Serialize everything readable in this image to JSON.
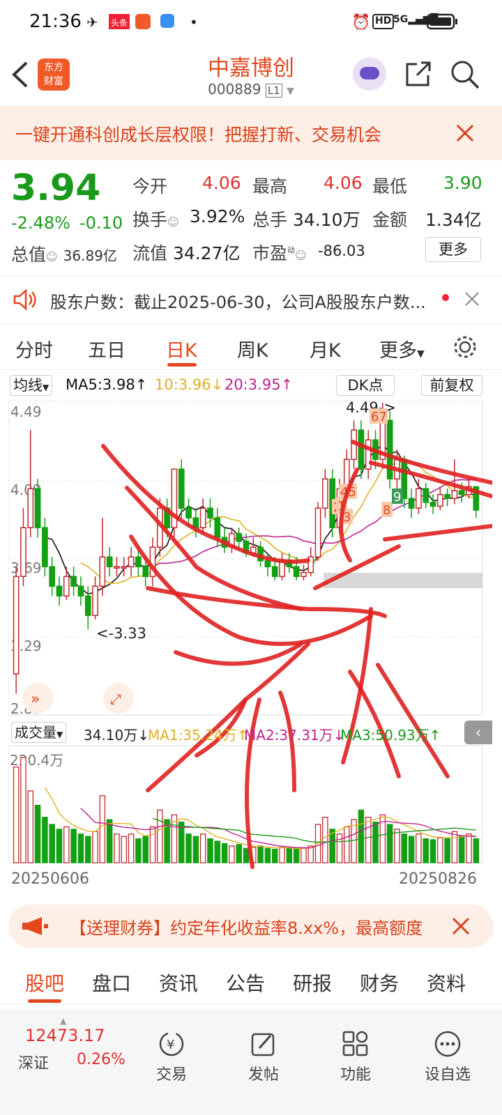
{
  "status": {
    "time": "21:36",
    "badge1": "头条",
    "net": "5G"
  },
  "header": {
    "logo_line1": "东方",
    "logo_line2": "财富",
    "title": "中嘉博创",
    "code": "000889",
    "level": "L1"
  },
  "banner": {
    "text": "一键开通科创成长层权限！把握打新、交易机会"
  },
  "quote": {
    "price": "3.94",
    "pct": "-2.48%",
    "chg": "-0.10",
    "open_label": "今开",
    "open": "4.06",
    "high_label": "最高",
    "high": "4.06",
    "low_label": "最低",
    "low": "3.90",
    "turnover_label": "换手",
    "turnover": "3.92%",
    "vol_label": "总手",
    "vol": "34.10万",
    "amt_label": "金额",
    "amt": "1.34亿",
    "mcap_label": "总值",
    "mcap": "36.89亿",
    "float_label": "流值",
    "float": "34.27亿",
    "pe_label": "市盈",
    "pe_sup": "动",
    "pe": "-86.03",
    "more": "更多"
  },
  "notice": {
    "text": "股东户数：截止2025-06-30，公司A股股东户数..."
  },
  "tabs": [
    "分时",
    "五日",
    "日K",
    "周K",
    "月K",
    "更多"
  ],
  "ma": {
    "selector": "均线",
    "ma5": "MA5:3.98",
    "ma10": "10:3.96",
    "ma20": "20:3.95",
    "dk": "DK点",
    "fq": "前复权"
  },
  "vol_legend": {
    "selector": "成交量",
    "vol": "34.10万",
    "ma1": "MA1:35.24万",
    "ma2": "MA2:37.31万",
    "ma3": "MA3:50.93万"
  },
  "chart_data": {
    "type": "candlestick",
    "y_ticks": [
      "4.49",
      "4.09",
      "3.69",
      "3.29",
      "2.89"
    ],
    "ylim": [
      2.89,
      4.49
    ],
    "high_annot": "4.49->",
    "low_annot": "<-3.33",
    "x_start": "20250606",
    "x_end": "20250826",
    "vol_max": "220.4万",
    "markers": [
      "67",
      "45",
      "2",
      "1",
      "3",
      "8",
      "9"
    ],
    "candles": [
      [
        3.1,
        3.6,
        3.0,
        3.65,
        1
      ],
      [
        3.6,
        3.85,
        3.55,
        3.95,
        1
      ],
      [
        3.85,
        4.05,
        3.8,
        4.35,
        1
      ],
      [
        4.05,
        3.85,
        3.8,
        4.1,
        0
      ],
      [
        3.85,
        3.65,
        3.6,
        3.9,
        0
      ],
      [
        3.65,
        3.55,
        3.5,
        3.7,
        0
      ],
      [
        3.55,
        3.5,
        3.45,
        3.6,
        0
      ],
      [
        3.5,
        3.6,
        3.48,
        3.65,
        1
      ],
      [
        3.6,
        3.55,
        3.5,
        3.65,
        0
      ],
      [
        3.55,
        3.5,
        3.45,
        3.6,
        0
      ],
      [
        3.5,
        3.4,
        3.33,
        3.55,
        0
      ],
      [
        3.4,
        3.55,
        3.38,
        3.6,
        1
      ],
      [
        3.55,
        3.7,
        3.5,
        3.9,
        1
      ],
      [
        3.7,
        3.65,
        3.6,
        3.75,
        0
      ],
      [
        3.65,
        3.65,
        3.6,
        3.7,
        1
      ],
      [
        3.65,
        3.65,
        3.6,
        3.7,
        1
      ],
      [
        3.65,
        3.7,
        3.6,
        3.75,
        1
      ],
      [
        3.7,
        3.65,
        3.6,
        3.75,
        0
      ],
      [
        3.65,
        3.6,
        3.55,
        3.7,
        0
      ],
      [
        3.6,
        3.75,
        3.55,
        3.8,
        1
      ],
      [
        3.75,
        3.95,
        3.7,
        4.0,
        1
      ],
      [
        3.95,
        3.85,
        3.8,
        4.0,
        0
      ],
      [
        3.85,
        4.15,
        3.8,
        4.15,
        1
      ],
      [
        4.15,
        3.95,
        3.9,
        4.2,
        0
      ],
      [
        3.95,
        3.9,
        3.85,
        4.0,
        0
      ],
      [
        3.9,
        3.85,
        3.8,
        3.95,
        0
      ],
      [
        3.85,
        3.95,
        3.82,
        4.0,
        1
      ],
      [
        3.95,
        3.9,
        3.85,
        4.0,
        0
      ],
      [
        3.9,
        3.8,
        3.75,
        3.95,
        0
      ],
      [
        3.8,
        3.75,
        3.72,
        3.85,
        0
      ],
      [
        3.75,
        3.82,
        3.72,
        3.85,
        1
      ],
      [
        3.82,
        3.78,
        3.74,
        3.85,
        0
      ],
      [
        3.78,
        3.72,
        3.7,
        3.82,
        0
      ],
      [
        3.72,
        3.75,
        3.7,
        3.8,
        1
      ],
      [
        3.75,
        3.68,
        3.65,
        3.78,
        0
      ],
      [
        3.68,
        3.65,
        3.6,
        3.72,
        0
      ],
      [
        3.65,
        3.6,
        3.58,
        3.7,
        0
      ],
      [
        3.6,
        3.68,
        3.58,
        3.72,
        1
      ],
      [
        3.68,
        3.65,
        3.62,
        3.72,
        0
      ],
      [
        3.65,
        3.6,
        3.58,
        3.7,
        0
      ],
      [
        3.6,
        3.62,
        3.58,
        3.66,
        1
      ],
      [
        3.62,
        3.7,
        3.6,
        3.75,
        1
      ],
      [
        3.7,
        3.95,
        3.68,
        3.98,
        1
      ],
      [
        3.95,
        4.1,
        3.9,
        4.15,
        1
      ],
      [
        4.1,
        3.85,
        3.8,
        4.15,
        0
      ],
      [
        3.85,
        4.05,
        3.82,
        4.1,
        1
      ],
      [
        4.05,
        4.2,
        4.0,
        4.25,
        1
      ],
      [
        4.2,
        4.35,
        4.15,
        4.4,
        1
      ],
      [
        4.35,
        4.15,
        4.1,
        4.4,
        0
      ],
      [
        4.15,
        4.3,
        4.1,
        4.35,
        1
      ],
      [
        4.3,
        4.2,
        4.15,
        4.35,
        0
      ],
      [
        4.2,
        4.4,
        4.15,
        4.49,
        1
      ],
      [
        4.4,
        4.1,
        4.05,
        4.45,
        0
      ],
      [
        4.1,
        4.2,
        4.05,
        4.25,
        1
      ],
      [
        4.2,
        4.0,
        3.95,
        4.22,
        0
      ],
      [
        4.0,
        3.95,
        3.9,
        4.05,
        0
      ],
      [
        3.95,
        4.05,
        3.92,
        4.1,
        1
      ],
      [
        4.05,
        3.98,
        3.95,
        4.08,
        0
      ],
      [
        3.98,
        3.96,
        3.92,
        4.02,
        0
      ],
      [
        3.96,
        4.02,
        3.94,
        4.06,
        1
      ],
      [
        4.02,
        4.0,
        3.96,
        4.05,
        0
      ],
      [
        4.0,
        4.04,
        3.97,
        4.2,
        1
      ],
      [
        4.04,
        4.02,
        3.98,
        4.08,
        0
      ],
      [
        4.02,
        4.06,
        4.0,
        4.1,
        1
      ],
      [
        4.06,
        3.94,
        3.9,
        4.06,
        0
      ]
    ],
    "volumes": [
      200,
      220,
      150,
      120,
      95,
      80,
      70,
      75,
      70,
      60,
      55,
      65,
      140,
      90,
      60,
      55,
      60,
      50,
      55,
      75,
      110,
      90,
      100,
      85,
      60,
      55,
      60,
      50,
      45,
      40,
      35,
      38,
      30,
      32,
      35,
      30,
      28,
      32,
      30,
      28,
      30,
      35,
      80,
      95,
      70,
      60,
      75,
      90,
      110,
      95,
      85,
      100,
      80,
      70,
      60,
      55,
      60,
      50,
      48,
      52,
      50,
      65,
      55,
      60,
      50
    ]
  },
  "promo": {
    "text": "【送理财券】约定年化收益率8.xx%，最高额度"
  },
  "subtabs": [
    "股吧",
    "盘口",
    "资讯",
    "公告",
    "研报",
    "财务",
    "资料"
  ],
  "bottom": {
    "index_val": "12473.17",
    "index_name": "深证",
    "index_pct": "0.26%",
    "trade": "交易",
    "post": "发帖",
    "func": "功能",
    "watch": "设自选"
  },
  "colors": {
    "up": "#c0282c",
    "down": "#13a013",
    "accent": "#e4471e",
    "ma5": "#111111",
    "ma10": "#e0b020",
    "ma20": "#c02090"
  }
}
